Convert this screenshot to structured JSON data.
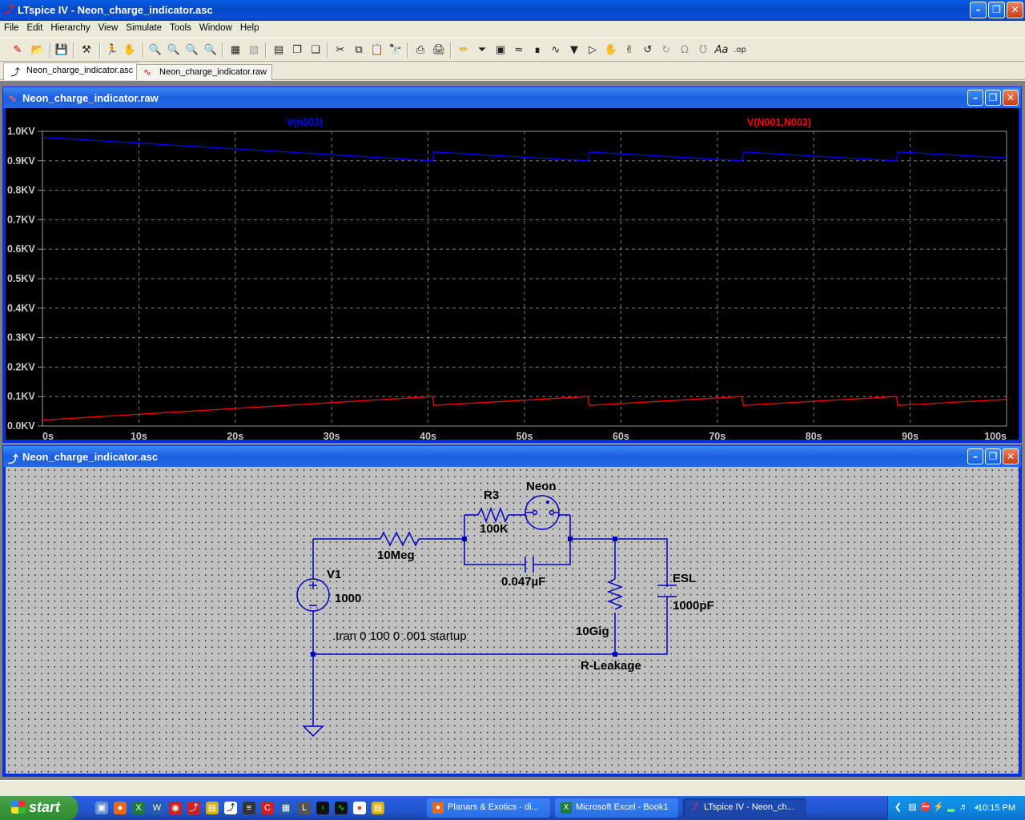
{
  "app": {
    "title": "LTspice IV - Neon_charge_indicator.asc"
  },
  "menu": [
    "File",
    "Edit",
    "Hierarchy",
    "View",
    "Simulate",
    "Tools",
    "Window",
    "Help"
  ],
  "tabs": [
    {
      "label": "Neon_charge_indicator.asc",
      "active": true
    },
    {
      "label": "Neon_charge_indicator.raw",
      "active": false
    }
  ],
  "waveform_window": {
    "title": "Neon_charge_indicator.raw"
  },
  "chart_data": {
    "type": "line",
    "xlabel": "",
    "ylabel": "",
    "xlim": [
      0,
      100
    ],
    "ylim": [
      0,
      1.0
    ],
    "x_ticks": [
      "0s",
      "10s",
      "20s",
      "30s",
      "40s",
      "50s",
      "60s",
      "70s",
      "80s",
      "90s",
      "100s"
    ],
    "y_ticks": [
      "0.0KV",
      "0.1KV",
      "0.2KV",
      "0.3KV",
      "0.4KV",
      "0.5KV",
      "0.6KV",
      "0.7KV",
      "0.8KV",
      "0.9KV",
      "1.0KV"
    ],
    "grid": true,
    "series": [
      {
        "name": "V(n003)",
        "color": "#0000ff",
        "x": [
          0,
          40.5,
          40.6,
          56.6,
          56.7,
          72.6,
          72.7,
          88.6,
          88.7,
          100
        ],
        "values": [
          0.98,
          0.9,
          0.93,
          0.9,
          0.93,
          0.9,
          0.93,
          0.9,
          0.93,
          0.91
        ]
      },
      {
        "name": "V(N001,N003)",
        "color": "#ff0000",
        "x": [
          0,
          40.5,
          40.6,
          56.6,
          56.7,
          72.6,
          72.7,
          88.6,
          88.7,
          100
        ],
        "values": [
          0.02,
          0.1,
          0.07,
          0.1,
          0.07,
          0.1,
          0.07,
          0.1,
          0.07,
          0.09
        ]
      }
    ]
  },
  "schematic_window": {
    "title": "Neon_charge_indicator.asc"
  },
  "schematic": {
    "r3_name": "R3",
    "r3_value": "100K",
    "neon_name": "Neon",
    "r_series_value": "10Meg",
    "c_value": "0.047µF",
    "v1_name": "V1",
    "v1_value": "1000",
    "directive": ".tran 0 100 0 .001 startup",
    "rleak_value": "10Gig",
    "rleak_name": "R-Leakage",
    "esl_name": "ESL",
    "esl_value": "1000pF"
  },
  "taskbar": {
    "start_label": "start",
    "tasks": [
      {
        "label": "Planars & Exotics - di...",
        "active": false
      },
      {
        "label": "Microsoft Excel - Book1",
        "active": false
      },
      {
        "label": "LTspice IV - Neon_ch...",
        "active": true
      }
    ],
    "clock": "10:15 PM"
  },
  "colors": {
    "plot_bg": "#000000",
    "trace_blue": "#0000ff",
    "trace_red": "#ff0000",
    "wire": "#0000c0",
    "schematic_bg": "#c0c0c0"
  }
}
